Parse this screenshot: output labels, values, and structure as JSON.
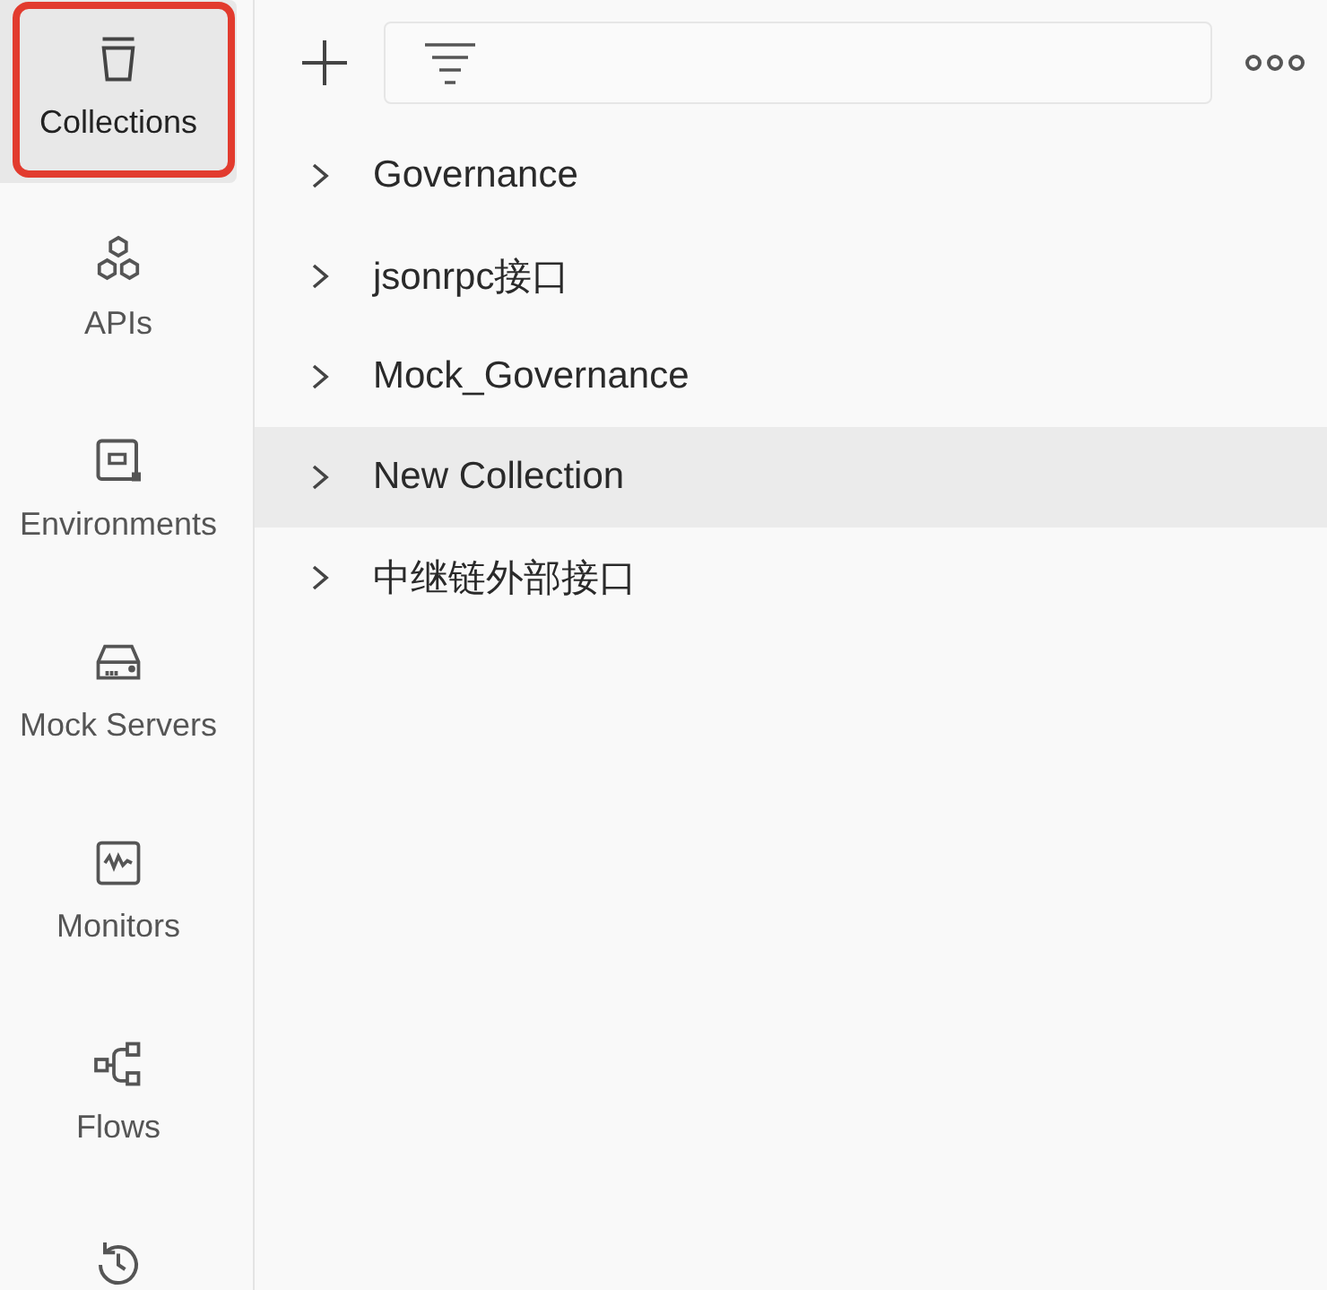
{
  "sidebar": {
    "items": [
      {
        "label": "Collections",
        "selected": true,
        "highlighted": true
      },
      {
        "label": "APIs",
        "selected": false,
        "highlighted": false
      },
      {
        "label": "Environments",
        "selected": false,
        "highlighted": false
      },
      {
        "label": "Mock Servers",
        "selected": false,
        "highlighted": false
      },
      {
        "label": "Monitors",
        "selected": false,
        "highlighted": false
      },
      {
        "label": "Flows",
        "selected": false,
        "highlighted": false
      },
      {
        "selected": false,
        "highlighted": false
      }
    ]
  },
  "collections": [
    {
      "name": "Governance",
      "selected": false
    },
    {
      "name": "jsonrpc接口",
      "selected": false
    },
    {
      "name": "Mock_Governance",
      "selected": false
    },
    {
      "name": "New Collection",
      "selected": true
    },
    {
      "name": "中继链外部接口",
      "selected": false
    }
  ]
}
